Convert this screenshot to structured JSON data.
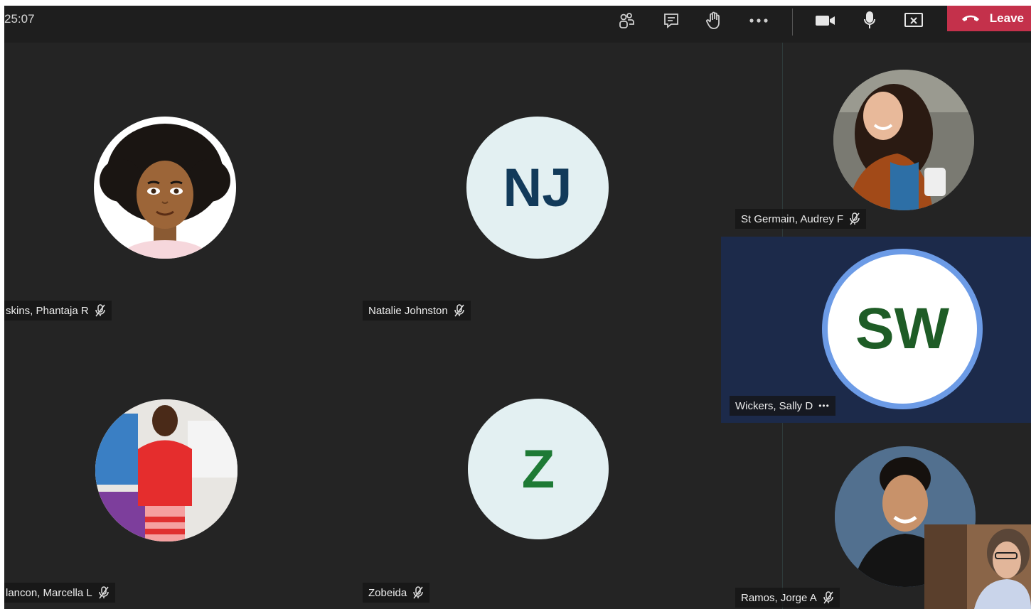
{
  "toolbar": {
    "timer": "25:07",
    "leave_label": "Leave",
    "icons": [
      "participants-icon",
      "chat-icon",
      "raise-hand-icon",
      "more-actions-icon",
      "camera-icon",
      "microphone-icon",
      "stop-share-icon",
      "hang-up-icon"
    ]
  },
  "participants": [
    {
      "name": "skins, Phantaja R",
      "avatar": "cartoon-avatar",
      "muted": true
    },
    {
      "name": "Natalie Johnston",
      "initials": "NJ",
      "muted": true
    },
    {
      "name": "St Germain, Audrey F",
      "avatar": "photo",
      "muted": true
    },
    {
      "name": "Wickers, Sally D",
      "initials": "SW",
      "speaking": true,
      "more": "•••"
    },
    {
      "name": "lancon, Marcella L",
      "avatar": "photo",
      "muted": true
    },
    {
      "name": "Zobeida",
      "initials": "Z",
      "muted": true
    },
    {
      "name": "Ramos, Jorge A",
      "avatar": "photo",
      "muted": true
    }
  ],
  "colors": {
    "stage_bg": "#242424",
    "leave_red": "#c4314b",
    "initials_bg": "#e3f0f2",
    "nj_text": "#123a5a",
    "z_text": "#1e7a35",
    "sw_text": "#1e5c26",
    "speaking_ring": "#6c9be6"
  }
}
